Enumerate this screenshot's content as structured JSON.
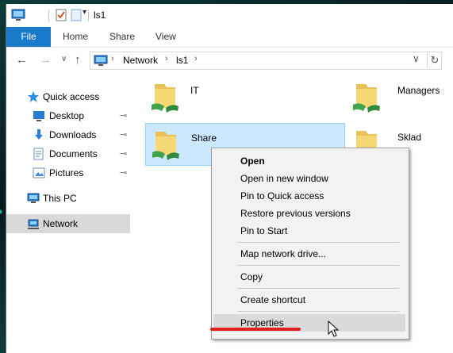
{
  "window": {
    "title": "ls1"
  },
  "ribbon": {
    "tabs": [
      "File",
      "Home",
      "Share",
      "View"
    ]
  },
  "address": {
    "segments": [
      "Network",
      "ls1"
    ],
    "chevron": "›",
    "dropdown_glyph": "∨",
    "refresh_glyph": "↻"
  },
  "navigation": {
    "back_glyph": "←",
    "forward_glyph": "→",
    "recent_glyph": "∨",
    "up_glyph": "↑"
  },
  "sidebar": {
    "items": [
      {
        "label": "Quick access",
        "icon": "star-icon"
      },
      {
        "label": "Desktop",
        "icon": "desktop-icon",
        "pinned": true
      },
      {
        "label": "Downloads",
        "icon": "downloads-icon",
        "pinned": true
      },
      {
        "label": "Documents",
        "icon": "documents-icon",
        "pinned": true
      },
      {
        "label": "Pictures",
        "icon": "pictures-icon",
        "pinned": true
      },
      {
        "label": "This PC",
        "icon": "this-pc-icon"
      },
      {
        "label": "Network",
        "icon": "network-icon",
        "selected": true
      }
    ],
    "pin_glyph": "📌"
  },
  "content": {
    "folders": [
      {
        "label": "IT"
      },
      {
        "label": "Managers"
      },
      {
        "label": "Share",
        "selected": true
      },
      {
        "label": "Sklad"
      }
    ]
  },
  "context_menu": {
    "items": [
      {
        "label": "Open",
        "bold": true
      },
      {
        "label": "Open in new window"
      },
      {
        "label": "Pin to Quick access"
      },
      {
        "label": "Restore previous versions"
      },
      {
        "label": "Pin to Start"
      },
      {
        "label": "Map network drive..."
      },
      {
        "label": "Copy"
      },
      {
        "label": "Create shortcut"
      },
      {
        "label": "Properties",
        "hover": true
      }
    ]
  },
  "colors": {
    "accent": "#1979ca",
    "selection": "#cce8ff",
    "highlight_mark": "#e02020"
  }
}
